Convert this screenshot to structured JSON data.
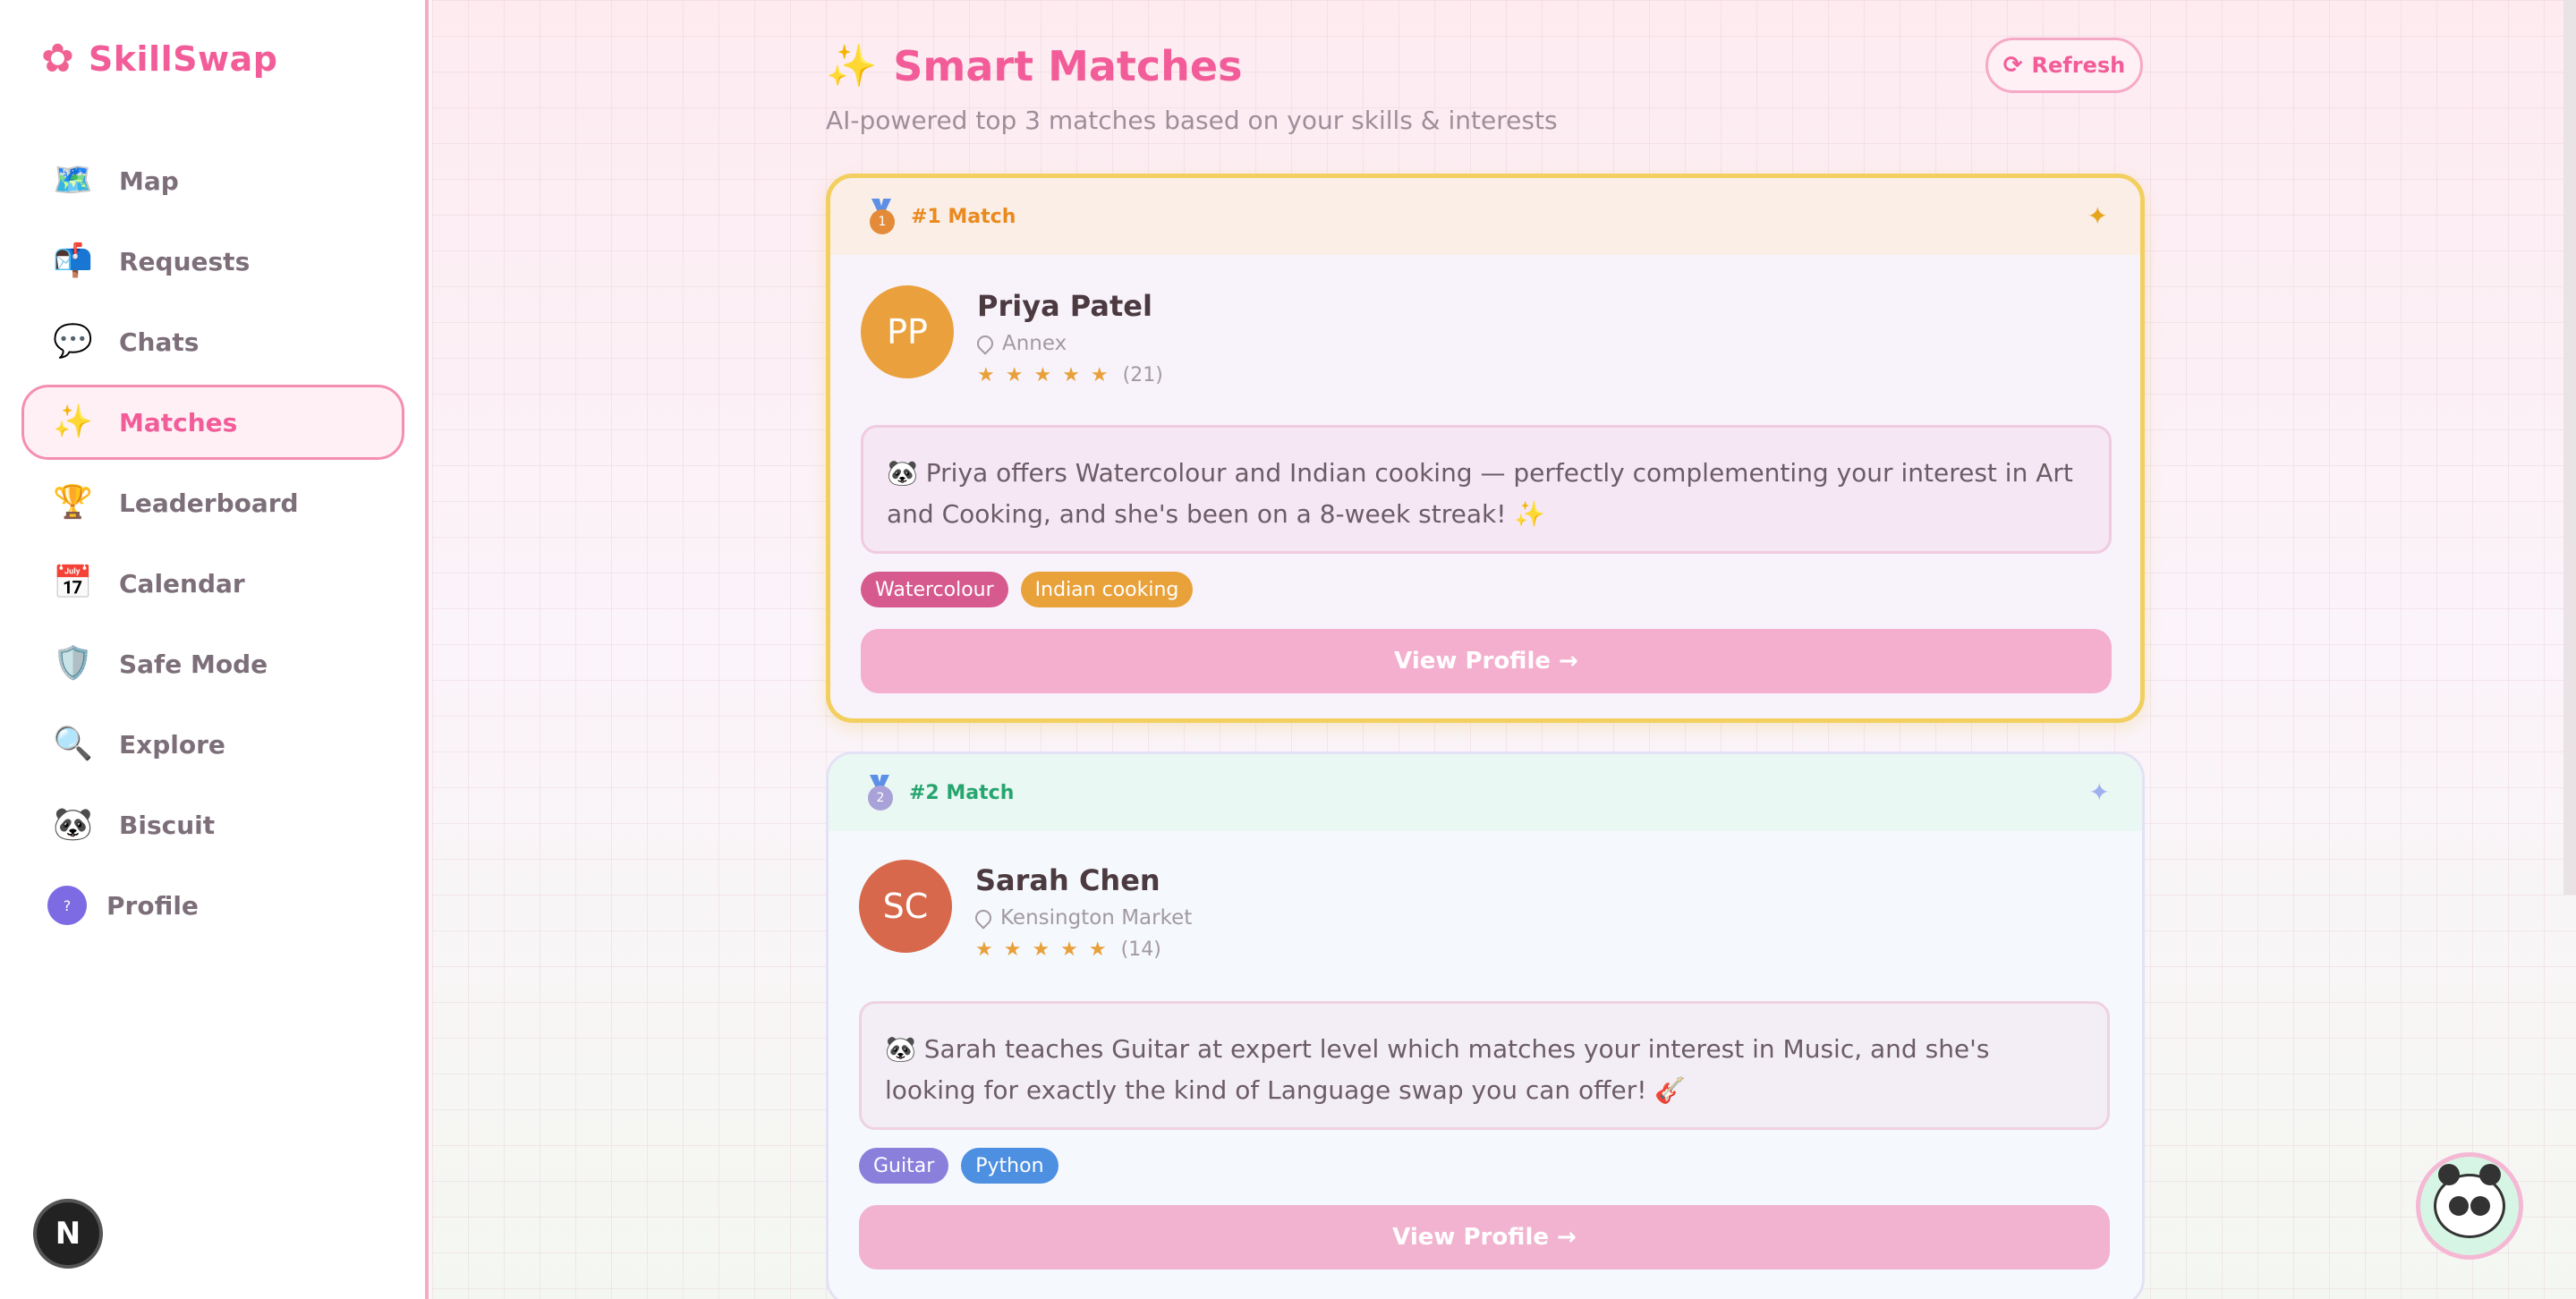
{
  "brand": {
    "name": "SkillSwap",
    "icon": "flower-icon"
  },
  "sidebar": {
    "items": [
      {
        "label": "Map",
        "icon": "🗺️"
      },
      {
        "label": "Requests",
        "icon": "📬"
      },
      {
        "label": "Chats",
        "icon": "💬"
      },
      {
        "label": "Matches",
        "icon": "✨",
        "active": true
      },
      {
        "label": "Leaderboard",
        "icon": "🏆"
      },
      {
        "label": "Calendar",
        "icon": "📅"
      },
      {
        "label": "Safe Mode",
        "icon": "🛡️"
      },
      {
        "label": "Explore",
        "icon": "🔍"
      },
      {
        "label": "Biscuit",
        "icon": "🐼"
      }
    ],
    "profile": {
      "label": "Profile",
      "avatar": "?"
    },
    "badge": "N"
  },
  "header": {
    "icon": "✨",
    "title": "Smart Matches",
    "subtitle": "AI-powered top 3 matches based on your skills & interests",
    "refresh_label": "Refresh",
    "refresh_icon": "⟳"
  },
  "matches": [
    {
      "rank_label": "#1 Match",
      "medal_num": "1",
      "initials": "PP",
      "name": "Priya Patel",
      "location": "Annex",
      "stars": "★★★★★",
      "review_count": "(21)",
      "reason": "🐼 Priya offers Watercolour and Indian cooking — perfectly complementing your interest in Art and Cooking, and she's been on a 8-week streak! ✨",
      "tags": [
        {
          "label": "Watercolour",
          "color": "#d65a8e"
        },
        {
          "label": "Indian cooking",
          "color": "#e9a13a"
        }
      ],
      "button_label": "View Profile →"
    },
    {
      "rank_label": "#2 Match",
      "medal_num": "2",
      "initials": "SC",
      "name": "Sarah Chen",
      "location": "Kensington Market",
      "stars": "★★★★★",
      "review_count": "(14)",
      "reason": "🐼 Sarah teaches Guitar at expert level which matches your interest in Music, and she's looking for exactly the kind of Language swap you can offer! 🎸",
      "tags": [
        {
          "label": "Guitar",
          "color": "#8b7fdc"
        },
        {
          "label": "Python",
          "color": "#4d8fe0"
        }
      ],
      "button_label": "View Profile →"
    }
  ],
  "colors": {
    "accent": "#f25d99",
    "gold": "#f2cf5f"
  }
}
